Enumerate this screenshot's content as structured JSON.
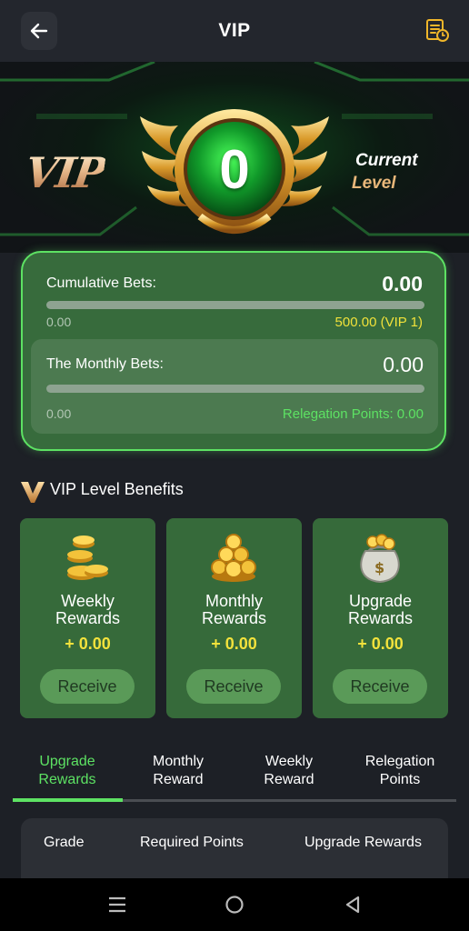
{
  "header": {
    "title": "VIP",
    "back_icon": "arrow-left-icon",
    "record_icon": "record-list-icon"
  },
  "hero": {
    "vip_text": "VIP",
    "current_level": "0",
    "current_label": "Current",
    "level_label": "Level"
  },
  "bets": {
    "cumulative_label": "Cumulative Bets:",
    "cumulative_value": "0.00",
    "cumulative_progress": 0,
    "cumulative_min": "0.00",
    "cumulative_target": "500.00 (VIP 1)",
    "monthly_label": "The Monthly Bets:",
    "monthly_value": "0.00",
    "monthly_progress": 0,
    "monthly_min": "0.00",
    "relegation_text": "Relegation Points: 0.00"
  },
  "benefits": {
    "title": "VIP Level Benefits",
    "cards": [
      {
        "name": "Weekly\nRewards",
        "amount": "+ 0.00",
        "button": "Receive",
        "icon": "coin-stack-icon"
      },
      {
        "name": "Monthly\nRewards",
        "amount": "+ 0.00",
        "button": "Receive",
        "icon": "coin-pile-icon"
      },
      {
        "name": "Upgrade\nRewards",
        "amount": "+ 0.00",
        "button": "Receive",
        "icon": "money-bag-icon"
      }
    ]
  },
  "tabs": [
    {
      "label": "Upgrade\nRewards",
      "active": true
    },
    {
      "label": "Monthly\nReward",
      "active": false
    },
    {
      "label": "Weekly\nReward",
      "active": false
    },
    {
      "label": "Relegation\nPoints",
      "active": false
    }
  ],
  "table": {
    "columns": [
      "Grade",
      "Required Points",
      "Upgrade Rewards"
    ]
  },
  "colors": {
    "accent": "#5de263",
    "card": "#366a3a",
    "gold": "#f3e23c",
    "background": "#1d2026"
  }
}
